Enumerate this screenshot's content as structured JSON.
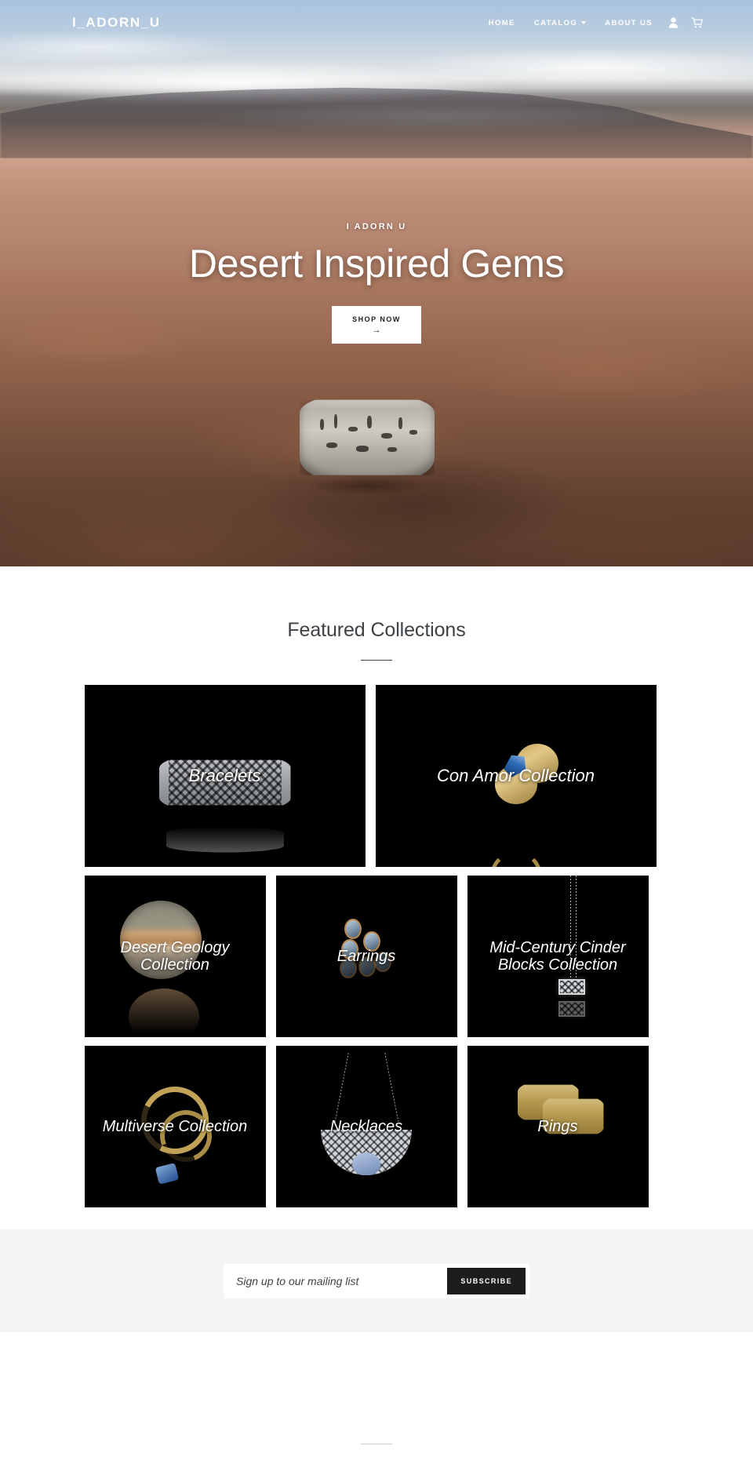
{
  "header": {
    "brand": "I_ADORN_U",
    "nav": [
      {
        "label": "HOME",
        "name": "nav-home",
        "has_caret": false
      },
      {
        "label": "CATALOG",
        "name": "nav-catalog",
        "has_caret": true
      },
      {
        "label": "ABOUT US",
        "name": "nav-about-us",
        "has_caret": false
      }
    ],
    "account_icon": "user-icon",
    "cart_icon": "cart-icon"
  },
  "hero": {
    "eyebrow": "I ADORN U",
    "title": "Desert Inspired Gems",
    "button_label": "SHOP NOW",
    "button_arrow": "→"
  },
  "collections": {
    "title": "Featured Collections",
    "tiles": [
      {
        "label": "Bracelets",
        "size": "half"
      },
      {
        "label": "Con Amor Collection",
        "size": "half"
      },
      {
        "label": "Desert Geology Collection",
        "size": "third"
      },
      {
        "label": "Earrings",
        "size": "third"
      },
      {
        "label": "Mid-Century Cinder Blocks Collection",
        "size": "third"
      },
      {
        "label": "Multiverse Collection",
        "size": "third"
      },
      {
        "label": "Necklaces",
        "size": "third"
      },
      {
        "label": "Rings",
        "size": "third"
      }
    ]
  },
  "newsletter": {
    "placeholder": "Sign up to our mailing list",
    "submit_label": "SUBSCRIBE"
  },
  "colors": {
    "dark": "#1c1d1d",
    "text": "#3d4246",
    "panel": "#f4f4f4",
    "tile_bg": "#000000",
    "white": "#ffffff"
  }
}
